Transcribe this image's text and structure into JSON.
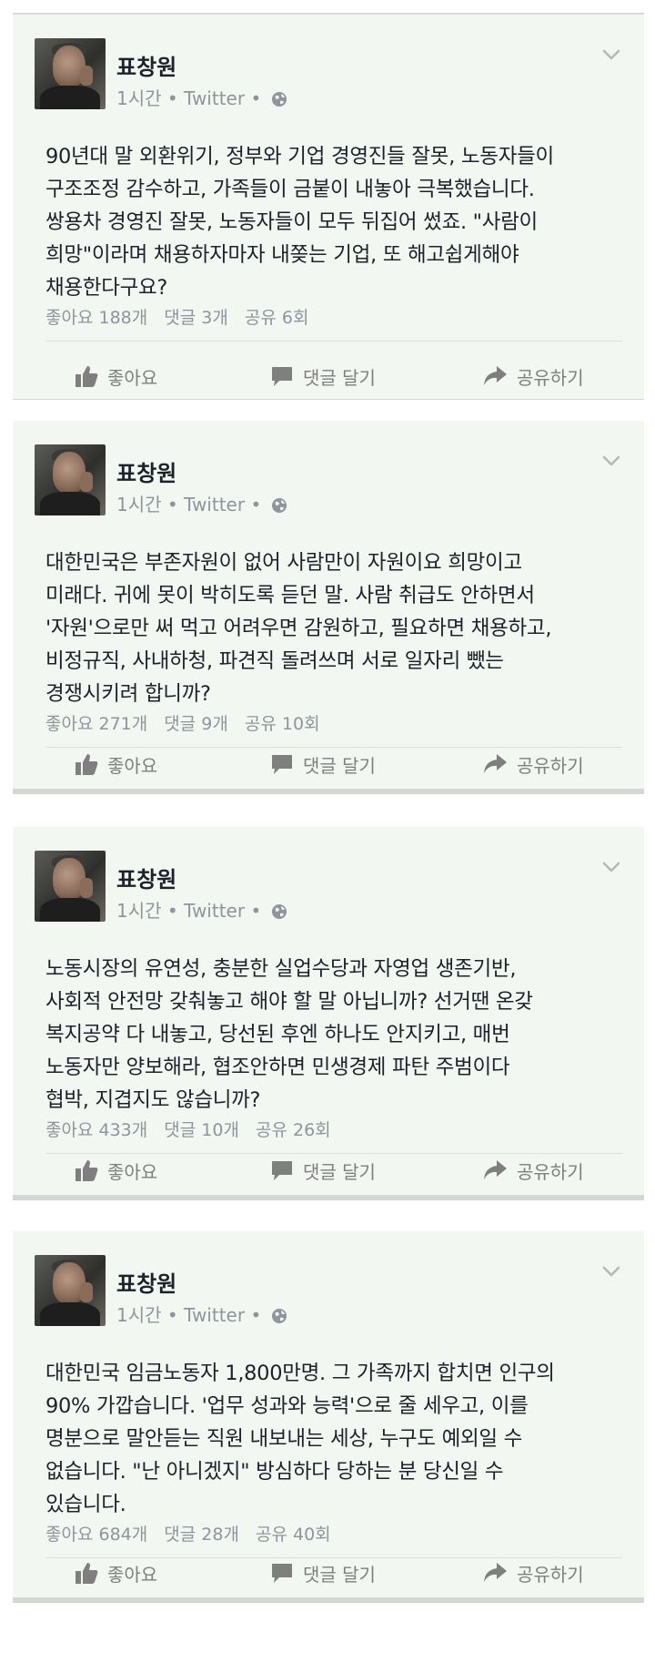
{
  "posts": [
    {
      "author": "표창원",
      "time": "1시간",
      "source": "Twitter",
      "text": "90년대 말 외환위기, 정부와 기업 경영진들 잘못, 노동자들이\n구조조정 감수하고, 가족들이 금붙이 내놓아 극복했습니다.\n쌍용차 경영진 잘못, 노동자들이 모두 뒤집어 썼죠. \"사람이\n희망\"이라며 채용하자마자 내쫒는 기업, 또 해고쉽게해야\n채용한다구요?",
      "likes": "좋아요 188개",
      "comments": "댓글 3개",
      "shares": "공유 6회"
    },
    {
      "author": "표창원",
      "time": "1시간",
      "source": "Twitter",
      "text": "대한민국은 부존자원이 없어 사람만이 자원이요 희망이고\n미래다. 귀에 못이 박히도록 듣던 말. 사람 취급도 안하면서\n'자원'으로만 써 먹고 어려우면 감원하고, 필요하면 채용하고,\n비정규직, 사내하청, 파견직 돌려쓰며 서로 일자리 뺐는\n경쟁시키려 합니까?",
      "likes": "좋아요 271개",
      "comments": "댓글 9개",
      "shares": "공유 10회"
    },
    {
      "author": "표창원",
      "time": "1시간",
      "source": "Twitter",
      "text": "노동시장의 유연성, 충분한 실업수당과 자영업 생존기반,\n사회적 안전망 갖춰놓고 해야 할 말 아닙니까? 선거땐 온갖\n복지공약 다 내놓고, 당선된 후엔 하나도 안지키고, 매번\n노동자만 양보해라, 협조안하면 민생경제 파탄 주범이다\n협박, 지겹지도 않습니까?",
      "likes": "좋아요 433개",
      "comments": "댓글 10개",
      "shares": "공유 26회"
    },
    {
      "author": "표창원",
      "time": "1시간",
      "source": "Twitter",
      "text": "대한민국 임금노동자 1,800만명. 그 가족까지 합치면 인구의\n90% 가깝습니다. '업무 성과와 능력'으로 줄 세우고, 이를\n명분으로 말안듣는 직원 내보내는 세상, 누구도 예외일 수\n없습니다. \"난 아니겠지\" 방심하다 당하는 분 당신일 수\n있습니다.",
      "likes": "좋아요 684개",
      "comments": "댓글 28개",
      "shares": "공유 40회"
    }
  ],
  "actions": {
    "like": "좋아요",
    "comment": "댓글 달기",
    "share": "공유하기"
  },
  "meta_separator": "•",
  "icons": [
    "globe-icon",
    "chevron-down-icon",
    "thumbs-up-icon",
    "comment-icon",
    "share-icon"
  ],
  "colors": {
    "card_bg": "#f2f7f2",
    "text": "#1d2129",
    "secondary": "#90949c",
    "action_icon": "#7f7f7f"
  }
}
